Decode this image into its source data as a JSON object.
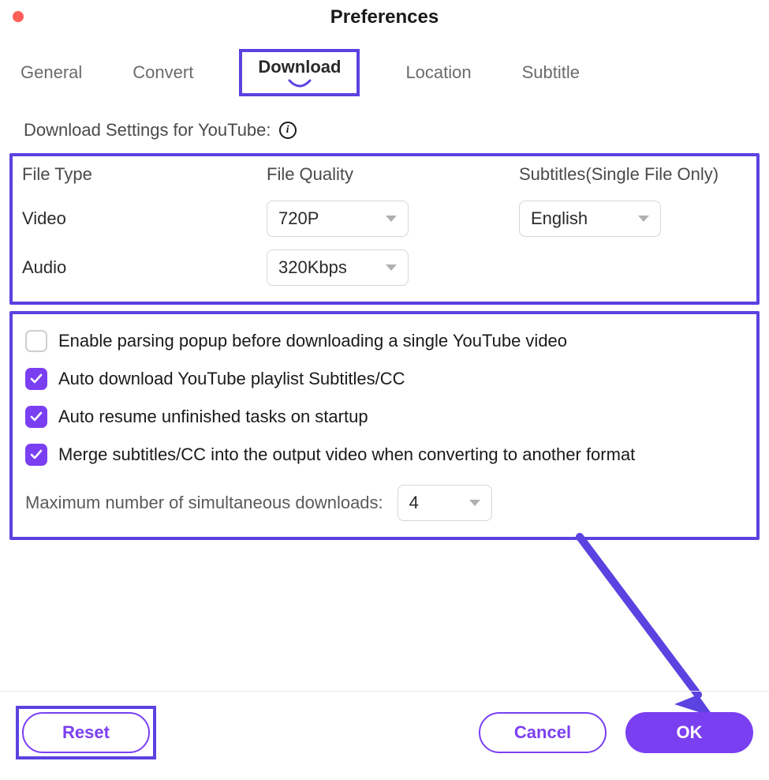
{
  "colors": {
    "accent": "#7b3ff2",
    "highlight_border": "#5a43e0"
  },
  "window": {
    "title": "Preferences"
  },
  "tabs": {
    "items": [
      "General",
      "Convert",
      "Download",
      "Location",
      "Subtitle"
    ],
    "active": "Download"
  },
  "heading": {
    "label": "Download Settings for YouTube:"
  },
  "table": {
    "headers": {
      "file_type": "File Type",
      "file_quality": "File Quality",
      "subtitles": "Subtitles(Single File Only)"
    },
    "rows": {
      "video": {
        "label": "Video",
        "quality": "720P",
        "subtitles": "English"
      },
      "audio": {
        "label": "Audio",
        "quality": "320Kbps"
      }
    }
  },
  "options": {
    "enable_parsing": {
      "label": "Enable parsing popup before downloading a single YouTube video",
      "checked": false
    },
    "auto_subs": {
      "label": "Auto download YouTube playlist Subtitles/CC",
      "checked": true
    },
    "auto_resume": {
      "label": "Auto resume unfinished tasks on startup",
      "checked": true
    },
    "merge_subs": {
      "label": "Merge subtitles/CC into the output video when converting to another format",
      "checked": true
    }
  },
  "max_downloads": {
    "label": "Maximum number of simultaneous downloads:",
    "value": "4"
  },
  "footer": {
    "reset": "Reset",
    "cancel": "Cancel",
    "ok": "OK"
  }
}
